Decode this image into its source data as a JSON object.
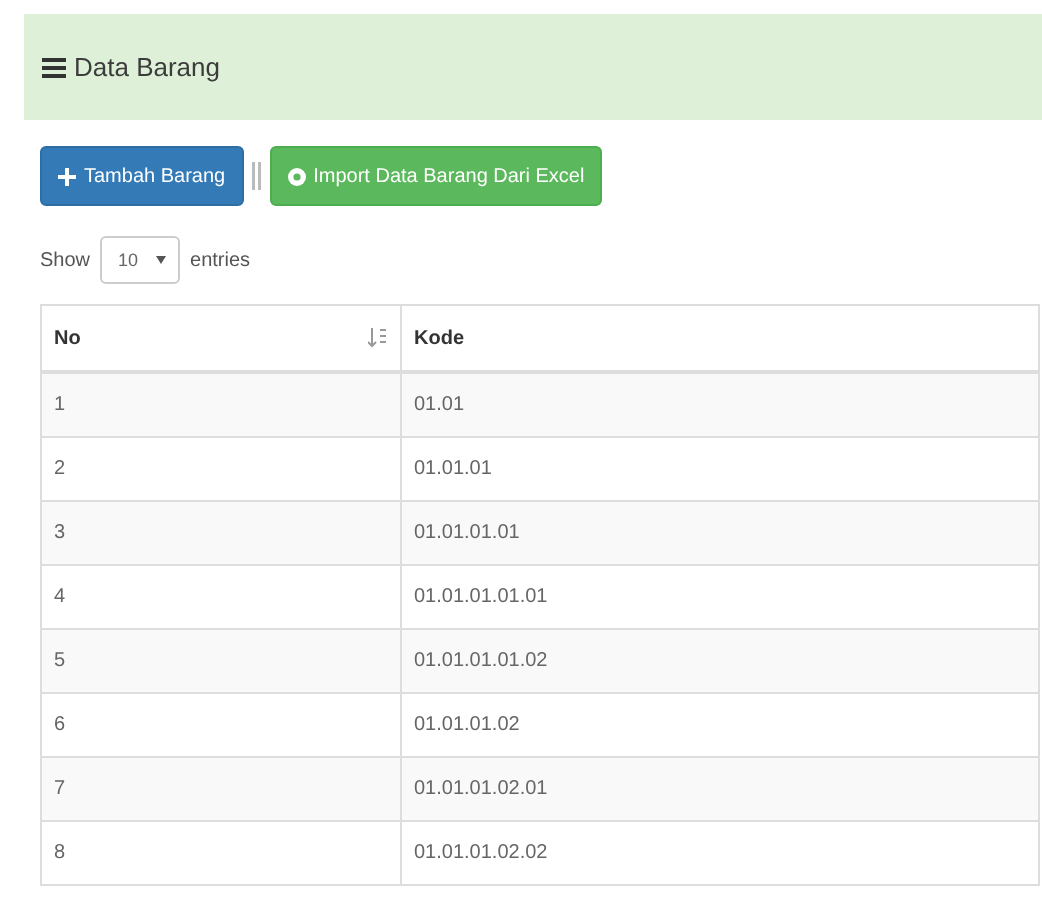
{
  "panel": {
    "title": "Data Barang"
  },
  "buttons": [
    {
      "label": "Tambah Barang",
      "kind": "add"
    },
    {
      "label": "Import Data Barang Dari Excel",
      "kind": "import"
    }
  ],
  "length": {
    "before": "Show",
    "value": "10",
    "after": "entries"
  },
  "table": {
    "columns": [
      {
        "label": "No",
        "sorted": true
      },
      {
        "label": "Kode",
        "sorted": false
      }
    ],
    "rows": [
      [
        "1",
        "01.01"
      ],
      [
        "2",
        "01.01.01"
      ],
      [
        "3",
        "01.01.01.01"
      ],
      [
        "4",
        "01.01.01.01.01"
      ],
      [
        "5",
        "01.01.01.01.02"
      ],
      [
        "6",
        "01.01.01.02"
      ],
      [
        "7",
        "01.01.01.02.01"
      ],
      [
        "8",
        "01.01.01.02.02"
      ]
    ]
  }
}
